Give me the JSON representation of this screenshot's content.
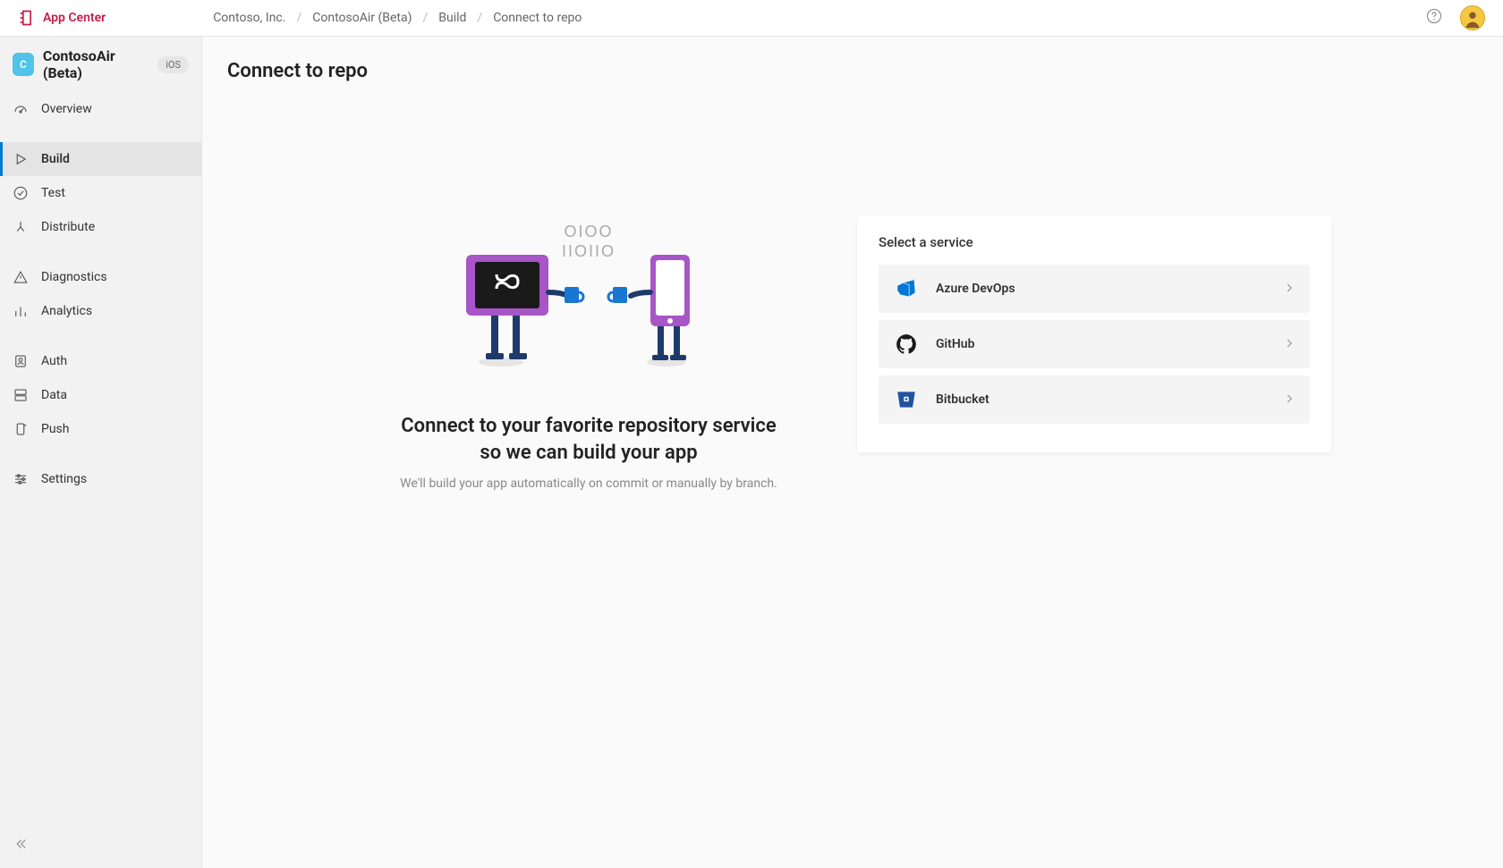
{
  "brand": {
    "name": "App Center"
  },
  "breadcrumb": {
    "items": [
      "Contoso, Inc.",
      "ContosoAir (Beta)",
      "Build",
      "Connect to repo"
    ]
  },
  "sidebar": {
    "app": {
      "initial": "C",
      "name": "ContosoAir (Beta)",
      "platform": "iOS"
    },
    "items": [
      {
        "label": "Overview",
        "icon": "gauge-icon",
        "active": false
      },
      {
        "label": "Build",
        "icon": "play-icon",
        "active": true
      },
      {
        "label": "Test",
        "icon": "check-circle-icon",
        "active": false
      },
      {
        "label": "Distribute",
        "icon": "distribute-icon",
        "active": false
      },
      {
        "label": "Diagnostics",
        "icon": "warning-icon",
        "active": false
      },
      {
        "label": "Analytics",
        "icon": "bar-chart-icon",
        "active": false
      },
      {
        "label": "Auth",
        "icon": "user-icon",
        "active": false
      },
      {
        "label": "Data",
        "icon": "data-icon",
        "active": false
      },
      {
        "label": "Push",
        "icon": "push-icon",
        "active": false
      },
      {
        "label": "Settings",
        "icon": "sliders-icon",
        "active": false
      }
    ]
  },
  "page": {
    "title": "Connect to repo",
    "hero_binary_line1": "OIOO",
    "hero_binary_line2": "IIOIIO",
    "hero_title": "Connect to your favorite repository service so we can build your app",
    "hero_sub": "We'll build your app automatically on commit or manually by branch."
  },
  "services": {
    "heading": "Select a service",
    "items": [
      {
        "name": "Azure DevOps",
        "icon": "azure-devops-icon"
      },
      {
        "name": "GitHub",
        "icon": "github-icon"
      },
      {
        "name": "Bitbucket",
        "icon": "bitbucket-icon"
      }
    ]
  }
}
